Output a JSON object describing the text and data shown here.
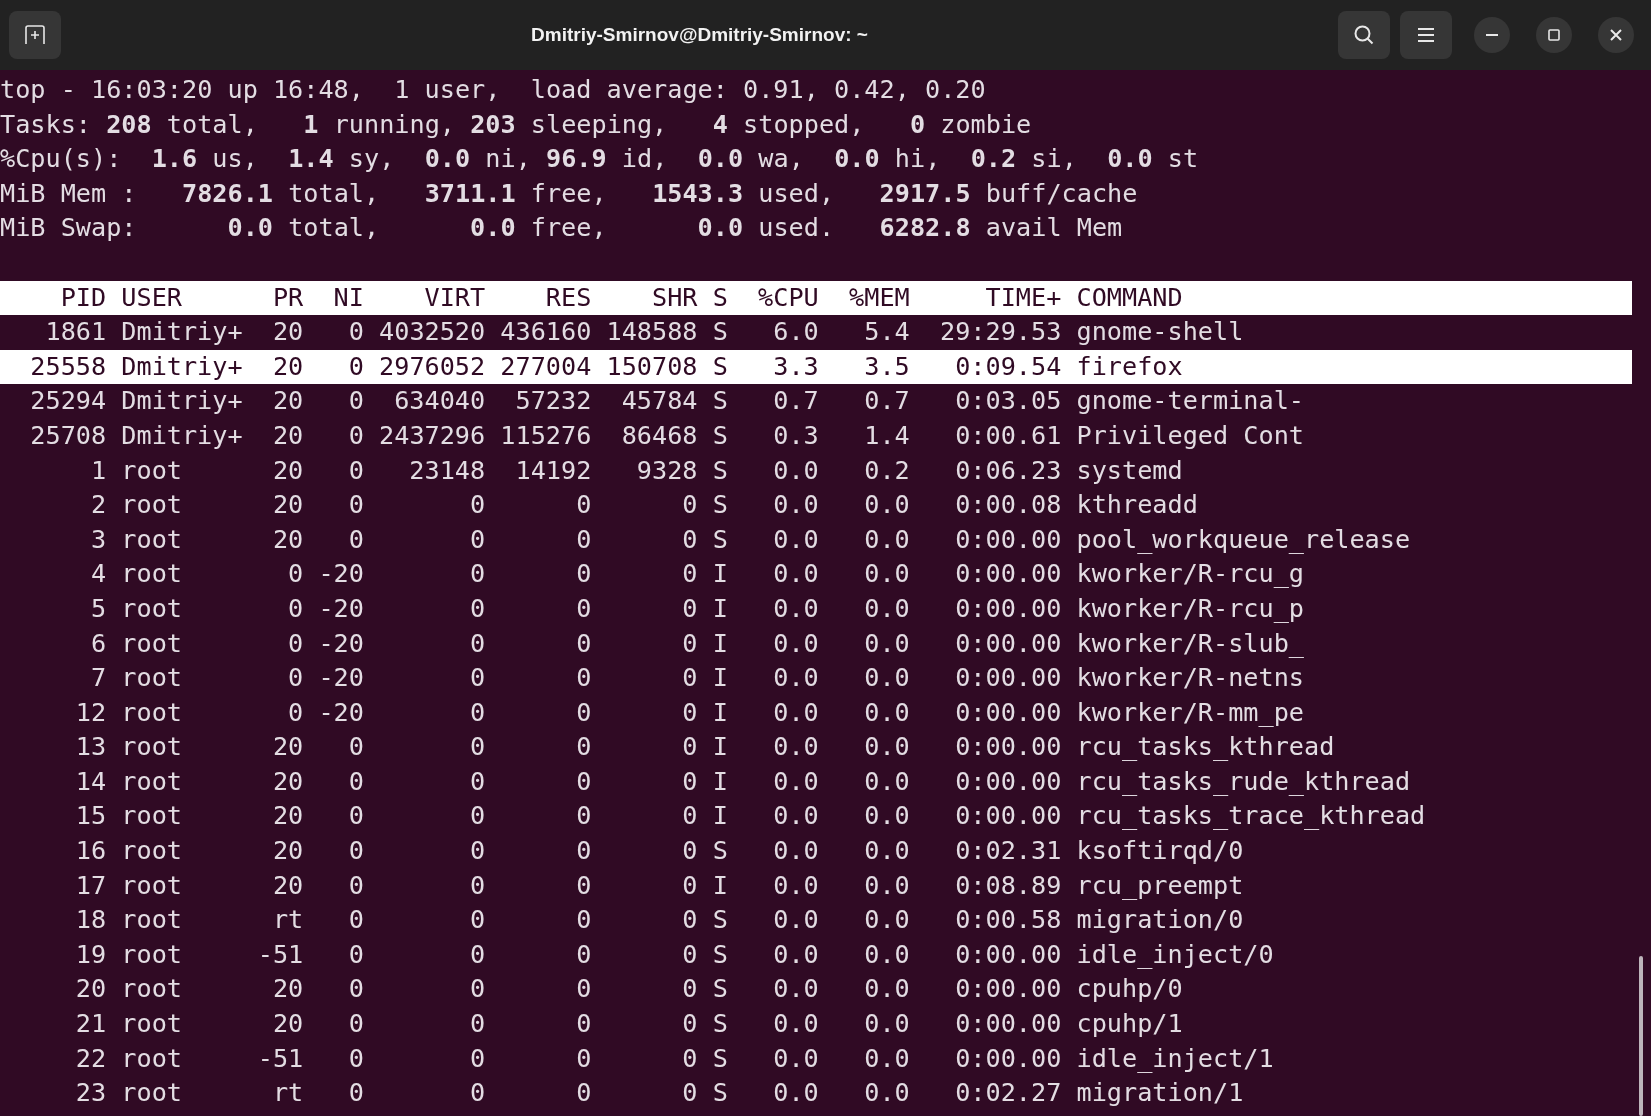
{
  "window": {
    "title": "Dmitriy-Smirnov@Dmitriy-Smirnov: ~"
  },
  "summary": [
    "top - 16:03:20 up 16:48,  1 user,  load average: 0.91, 0.42, 0.20",
    "Tasks: **208** total,   **1** running, **203** sleeping,   **4** stopped,   **0** zombie",
    "%Cpu(s):  **1.6** us,  **1.4** sy,  **0.0** ni, **96.9** id,  **0.0** wa,  **0.0** hi,  **0.2** si,  **0.0** st",
    "MiB Mem :   **7826.1** total,   **3711.1** free,   **1543.3** used,   **2917.5** buff/cache",
    "MiB Swap:      **0.0** total,      **0.0** free,      **0.0** used.   **6282.8** avail Mem"
  ],
  "table": {
    "columns": [
      "PID",
      "USER",
      "PR",
      "NI",
      "VIRT",
      "RES",
      "SHR",
      "S",
      "%CPU",
      "%MEM",
      "TIME+",
      "COMMAND"
    ],
    "rows": [
      {
        "cells": [
          "1861",
          "Dmitriy+",
          "20",
          "0",
          "4032520",
          "436160",
          "148588",
          "S",
          "6.0",
          "5.4",
          "29:29.53",
          "gnome-shell"
        ],
        "selected": false
      },
      {
        "cells": [
          "25558",
          "Dmitriy+",
          "20",
          "0",
          "2976052",
          "277004",
          "150708",
          "S",
          "3.3",
          "3.5",
          "0:09.54",
          "firefox"
        ],
        "selected": true
      },
      {
        "cells": [
          "25294",
          "Dmitriy+",
          "20",
          "0",
          "634040",
          "57232",
          "45784",
          "S",
          "0.7",
          "0.7",
          "0:03.05",
          "gnome-terminal-"
        ],
        "selected": false
      },
      {
        "cells": [
          "25708",
          "Dmitriy+",
          "20",
          "0",
          "2437296",
          "115276",
          "86468",
          "S",
          "0.3",
          "1.4",
          "0:00.61",
          "Privileged Cont"
        ],
        "selected": false
      },
      {
        "cells": [
          "1",
          "root",
          "20",
          "0",
          "23148",
          "14192",
          "9328",
          "S",
          "0.0",
          "0.2",
          "0:06.23",
          "systemd"
        ],
        "selected": false
      },
      {
        "cells": [
          "2",
          "root",
          "20",
          "0",
          "0",
          "0",
          "0",
          "S",
          "0.0",
          "0.0",
          "0:00.08",
          "kthreadd"
        ],
        "selected": false
      },
      {
        "cells": [
          "3",
          "root",
          "20",
          "0",
          "0",
          "0",
          "0",
          "S",
          "0.0",
          "0.0",
          "0:00.00",
          "pool_workqueue_release"
        ],
        "selected": false
      },
      {
        "cells": [
          "4",
          "root",
          "0",
          "-20",
          "0",
          "0",
          "0",
          "I",
          "0.0",
          "0.0",
          "0:00.00",
          "kworker/R-rcu_g"
        ],
        "selected": false
      },
      {
        "cells": [
          "5",
          "root",
          "0",
          "-20",
          "0",
          "0",
          "0",
          "I",
          "0.0",
          "0.0",
          "0:00.00",
          "kworker/R-rcu_p"
        ],
        "selected": false
      },
      {
        "cells": [
          "6",
          "root",
          "0",
          "-20",
          "0",
          "0",
          "0",
          "I",
          "0.0",
          "0.0",
          "0:00.00",
          "kworker/R-slub_"
        ],
        "selected": false
      },
      {
        "cells": [
          "7",
          "root",
          "0",
          "-20",
          "0",
          "0",
          "0",
          "I",
          "0.0",
          "0.0",
          "0:00.00",
          "kworker/R-netns"
        ],
        "selected": false
      },
      {
        "cells": [
          "12",
          "root",
          "0",
          "-20",
          "0",
          "0",
          "0",
          "I",
          "0.0",
          "0.0",
          "0:00.00",
          "kworker/R-mm_pe"
        ],
        "selected": false
      },
      {
        "cells": [
          "13",
          "root",
          "20",
          "0",
          "0",
          "0",
          "0",
          "I",
          "0.0",
          "0.0",
          "0:00.00",
          "rcu_tasks_kthread"
        ],
        "selected": false
      },
      {
        "cells": [
          "14",
          "root",
          "20",
          "0",
          "0",
          "0",
          "0",
          "I",
          "0.0",
          "0.0",
          "0:00.00",
          "rcu_tasks_rude_kthread"
        ],
        "selected": false
      },
      {
        "cells": [
          "15",
          "root",
          "20",
          "0",
          "0",
          "0",
          "0",
          "I",
          "0.0",
          "0.0",
          "0:00.00",
          "rcu_tasks_trace_kthread"
        ],
        "selected": false
      },
      {
        "cells": [
          "16",
          "root",
          "20",
          "0",
          "0",
          "0",
          "0",
          "S",
          "0.0",
          "0.0",
          "0:02.31",
          "ksoftirqd/0"
        ],
        "selected": false
      },
      {
        "cells": [
          "17",
          "root",
          "20",
          "0",
          "0",
          "0",
          "0",
          "I",
          "0.0",
          "0.0",
          "0:08.89",
          "rcu_preempt"
        ],
        "selected": false
      },
      {
        "cells": [
          "18",
          "root",
          "rt",
          "0",
          "0",
          "0",
          "0",
          "S",
          "0.0",
          "0.0",
          "0:00.58",
          "migration/0"
        ],
        "selected": false
      },
      {
        "cells": [
          "19",
          "root",
          "-51",
          "0",
          "0",
          "0",
          "0",
          "S",
          "0.0",
          "0.0",
          "0:00.00",
          "idle_inject/0"
        ],
        "selected": false
      },
      {
        "cells": [
          "20",
          "root",
          "20",
          "0",
          "0",
          "0",
          "0",
          "S",
          "0.0",
          "0.0",
          "0:00.00",
          "cpuhp/0"
        ],
        "selected": false
      },
      {
        "cells": [
          "21",
          "root",
          "20",
          "0",
          "0",
          "0",
          "0",
          "S",
          "0.0",
          "0.0",
          "0:00.00",
          "cpuhp/1"
        ],
        "selected": false
      },
      {
        "cells": [
          "22",
          "root",
          "-51",
          "0",
          "0",
          "0",
          "0",
          "S",
          "0.0",
          "0.0",
          "0:00.00",
          "idle_inject/1"
        ],
        "selected": false
      },
      {
        "cells": [
          "23",
          "root",
          "rt",
          "0",
          "0",
          "0",
          "0",
          "S",
          "0.0",
          "0.0",
          "0:02.27",
          "migration/1"
        ],
        "selected": false
      }
    ]
  }
}
